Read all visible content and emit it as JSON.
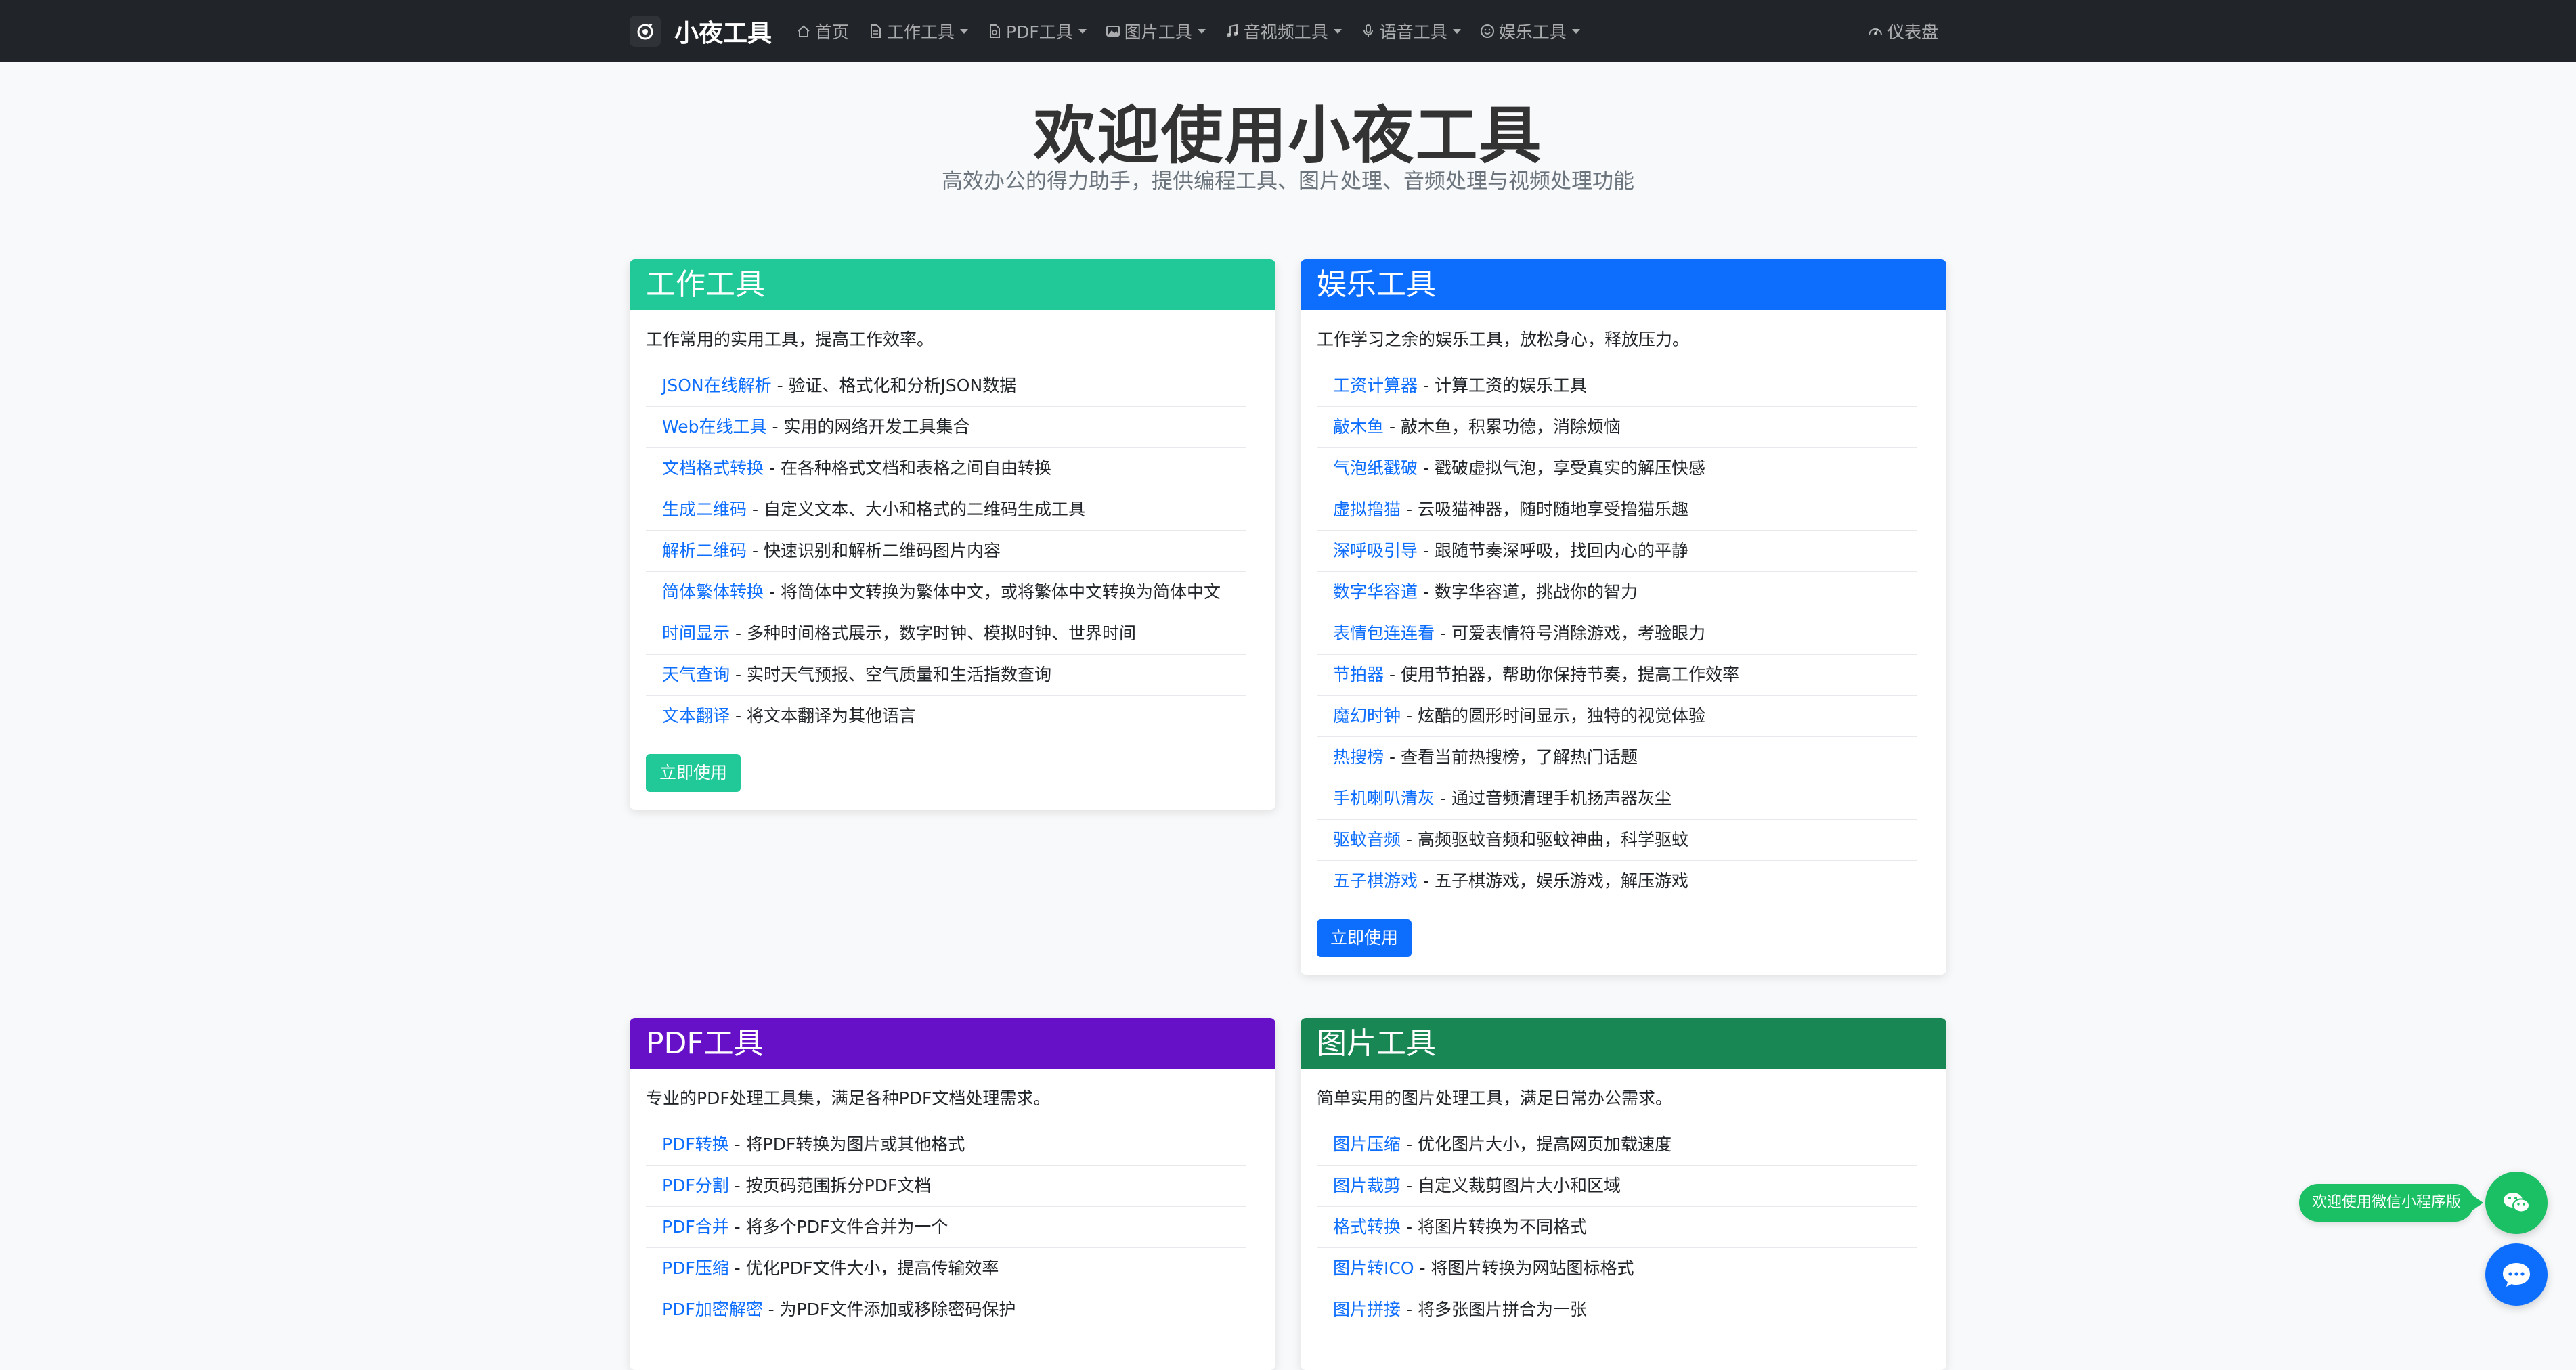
{
  "navbar": {
    "brand": "小夜工具",
    "items": [
      {
        "label": "首页",
        "icon": "house-icon",
        "dropdown": false
      },
      {
        "label": "工作工具",
        "icon": "document-icon",
        "dropdown": true
      },
      {
        "label": "PDF工具",
        "icon": "pdf-file-icon",
        "dropdown": true
      },
      {
        "label": "图片工具",
        "icon": "image-icon",
        "dropdown": true
      },
      {
        "label": "音视频工具",
        "icon": "music-note-icon",
        "dropdown": true
      },
      {
        "label": "语音工具",
        "icon": "microphone-icon",
        "dropdown": true
      },
      {
        "label": "娱乐工具",
        "icon": "smile-icon",
        "dropdown": true
      }
    ],
    "dashboard": {
      "label": "仪表盘",
      "icon": "speedometer-icon"
    }
  },
  "hero": {
    "title": "欢迎使用小夜工具",
    "subtitle": "高效办公的得力助手，提供编程工具、图片处理、音频处理与视频处理功能"
  },
  "cards": {
    "work": {
      "title": "工作工具",
      "color": "#20c997",
      "description": "工作常用的实用工具，提高工作效率。",
      "button": "立即使用",
      "items": [
        {
          "name": "JSON在线解析",
          "desc": "验证、格式化和分析JSON数据"
        },
        {
          "name": "Web在线工具",
          "desc": "实用的网络开发工具集合"
        },
        {
          "name": "文档格式转换",
          "desc": "在各种格式文档和表格之间自由转换"
        },
        {
          "name": "生成二维码",
          "desc": "自定义文本、大小和格式的二维码生成工具"
        },
        {
          "name": "解析二维码",
          "desc": "快速识别和解析二维码图片内容"
        },
        {
          "name": "简体繁体转换",
          "desc": "将简体中文转换为繁体中文，或将繁体中文转换为简体中文"
        },
        {
          "name": "时间显示",
          "desc": "多种时间格式展示，数字时钟、模拟时钟、世界时间"
        },
        {
          "name": "天气查询",
          "desc": "实时天气预报、空气质量和生活指数查询"
        },
        {
          "name": "文本翻译",
          "desc": "将文本翻译为其他语言"
        }
      ]
    },
    "fun": {
      "title": "娱乐工具",
      "color": "#0d6efd",
      "description": "工作学习之余的娱乐工具，放松身心，释放压力。",
      "button": "立即使用",
      "items": [
        {
          "name": "工资计算器",
          "desc": "计算工资的娱乐工具"
        },
        {
          "name": "敲木鱼",
          "desc": "敲木鱼，积累功德，消除烦恼"
        },
        {
          "name": "气泡纸戳破",
          "desc": "戳破虚拟气泡，享受真实的解压快感"
        },
        {
          "name": "虚拟撸猫",
          "desc": "云吸猫神器，随时随地享受撸猫乐趣"
        },
        {
          "name": "深呼吸引导",
          "desc": "跟随节奏深呼吸，找回内心的平静"
        },
        {
          "name": "数字华容道",
          "desc": "数字华容道，挑战你的智力"
        },
        {
          "name": "表情包连连看",
          "desc": "可爱表情符号消除游戏，考验眼力"
        },
        {
          "name": "节拍器",
          "desc": "使用节拍器，帮助你保持节奏，提高工作效率"
        },
        {
          "name": "魔幻时钟",
          "desc": "炫酷的圆形时间显示，独特的视觉体验"
        },
        {
          "name": "热搜榜",
          "desc": "查看当前热搜榜，了解热门话题"
        },
        {
          "name": "手机喇叭清灰",
          "desc": "通过音频清理手机扬声器灰尘"
        },
        {
          "name": "驱蚊音频",
          "desc": "高频驱蚊音频和驱蚊神曲，科学驱蚊"
        },
        {
          "name": "五子棋游戏",
          "desc": "五子棋游戏，娱乐游戏，解压游戏"
        }
      ]
    },
    "pdf": {
      "title": "PDF工具",
      "color": "#6610c8",
      "description": "专业的PDF处理工具集，满足各种PDF文档处理需求。",
      "items": [
        {
          "name": "PDF转换",
          "desc": "将PDF转换为图片或其他格式"
        },
        {
          "name": "PDF分割",
          "desc": "按页码范围拆分PDF文档"
        },
        {
          "name": "PDF合并",
          "desc": "将多个PDF文件合并为一个"
        },
        {
          "name": "PDF压缩",
          "desc": "优化PDF文件大小，提高传输效率"
        },
        {
          "name": "PDF加密解密",
          "desc": "为PDF文件添加或移除密码保护"
        }
      ]
    },
    "image": {
      "title": "图片工具",
      "color": "#198754",
      "description": "简单实用的图片处理工具，满足日常办公需求。",
      "items": [
        {
          "name": "图片压缩",
          "desc": "优化图片大小，提高网页加载速度"
        },
        {
          "name": "图片裁剪",
          "desc": "自定义裁剪图片大小和区域"
        },
        {
          "name": "格式转换",
          "desc": "将图片转换为不同格式"
        },
        {
          "name": "图片转ICO",
          "desc": "将图片转换为网站图标格式"
        },
        {
          "name": "图片拼接",
          "desc": "将多张图片拼合为一张"
        }
      ]
    }
  },
  "float": {
    "mini_program_tip": "欢迎使用微信小程序版",
    "wechat_icon": "wechat-icon",
    "chat_icon": "chat-bubble-icon"
  }
}
